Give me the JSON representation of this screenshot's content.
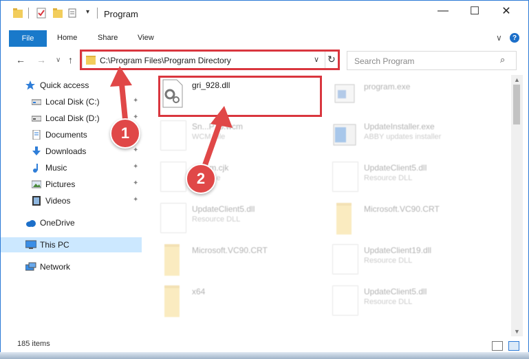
{
  "window": {
    "title": "Program",
    "controls": {
      "minimize": "—",
      "maximize": "☐",
      "close": "✕"
    }
  },
  "ribbon": {
    "tabs": [
      "File",
      "Home",
      "Share",
      "View"
    ],
    "expand_glyph": "∨",
    "help_glyph": "?"
  },
  "nav": {
    "back_glyph": "←",
    "forward_glyph": "→",
    "recent_glyph": "∨",
    "up_glyph": "↑",
    "address": "C:\\Program Files\\Program Directory",
    "address_dropdown_glyph": "∨",
    "refresh_glyph": "↻",
    "search_placeholder": "Search Program",
    "search_icon": "⌕"
  },
  "sidebar": {
    "items": [
      {
        "label": "Quick access",
        "icon": "star-icon",
        "pinned": false
      },
      {
        "label": "Local Disk (C:)",
        "icon": "drive-icon",
        "pinned": true
      },
      {
        "label": "Local Disk (D:)",
        "icon": "drive-icon",
        "pinned": true
      },
      {
        "label": "Documents",
        "icon": "documents-icon",
        "pinned": true
      },
      {
        "label": "Downloads",
        "icon": "download-icon",
        "pinned": true
      },
      {
        "label": "Music",
        "icon": "music-icon",
        "pinned": true
      },
      {
        "label": "Pictures",
        "icon": "pictures-icon",
        "pinned": true
      },
      {
        "label": "Videos",
        "icon": "videos-icon",
        "pinned": true
      },
      {
        "label": "OneDrive",
        "icon": "cloud-icon",
        "pinned": false
      },
      {
        "label": "This PC",
        "icon": "pc-icon",
        "pinned": false,
        "selected": true
      },
      {
        "label": "Network",
        "icon": "network-icon",
        "pinned": false
      }
    ],
    "pin_glyph": "📌"
  },
  "files": {
    "highlighted": {
      "name": "gri_928.dll",
      "icon": "dll-gear-icon"
    },
    "others": [
      {
        "name": "program.exe",
        "type": "",
        "icon": "exe-icon"
      },
      {
        "name": "Sn...P15.wcm",
        "type": "WCM File",
        "icon": "document-icon"
      },
      {
        "name": "UpdateInstaller.exe",
        "type": "ABBY updates installer",
        "icon": "installer-icon"
      },
      {
        "name": "...Com.cjk",
        "type": "CJK File",
        "icon": "document-icon"
      },
      {
        "name": "UpdateClient5.dll",
        "type": "Resource DLL",
        "icon": "dll-gear-icon"
      },
      {
        "name": "UpdateClient5.dll",
        "type": "Resource DLL",
        "icon": "dll-gear-icon"
      },
      {
        "name": "Microsoft.VC90.CRT",
        "type": "",
        "icon": "folder-icon"
      },
      {
        "name": "Microsoft.VC90.CRT",
        "type": "",
        "icon": "folder-icon"
      },
      {
        "name": "UpdateClient19.dll",
        "type": "Resource DLL",
        "icon": "dll-gear-icon"
      },
      {
        "name": "x64",
        "type": "",
        "icon": "folder-icon"
      },
      {
        "name": "UpdateClient5.dll",
        "type": "Resource DLL",
        "icon": "dll-gear-icon"
      }
    ]
  },
  "status": {
    "item_count": "185 items"
  },
  "callouts": [
    "1",
    "2"
  ],
  "colors": {
    "accent": "#1979ca",
    "highlight_border": "#d9363e",
    "callout": "#e04848",
    "selected_bg": "#cce8ff"
  }
}
